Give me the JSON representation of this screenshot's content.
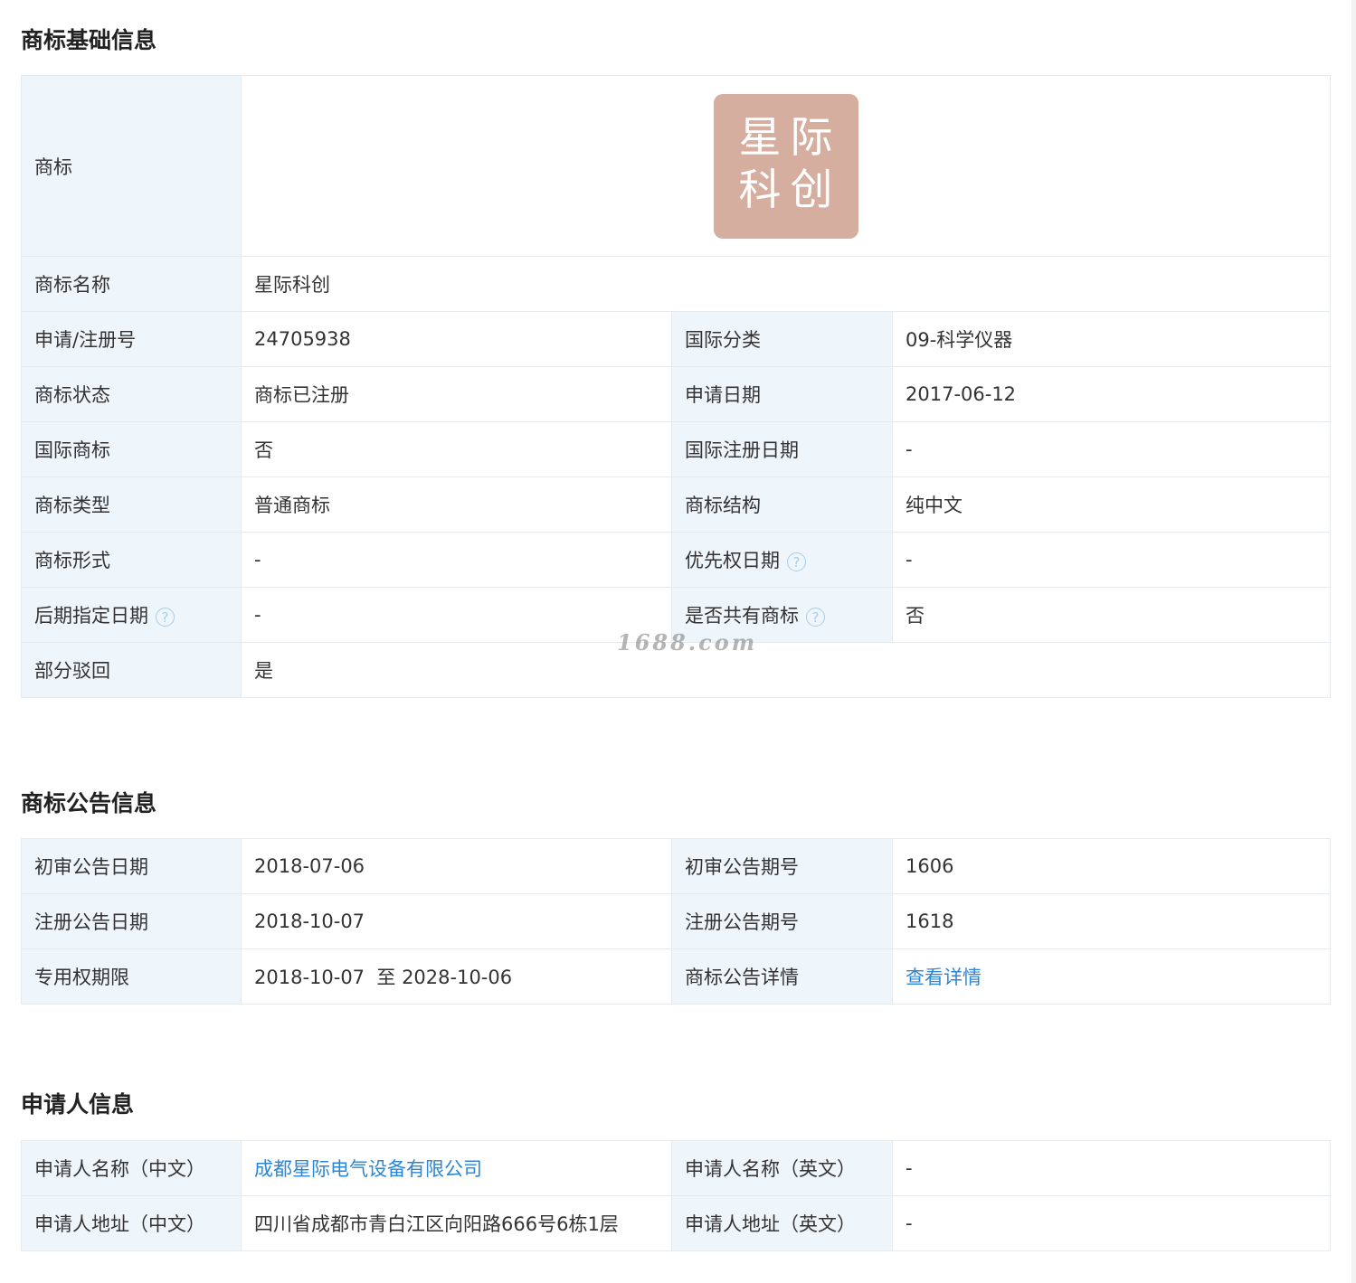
{
  "basic": {
    "title": "商标基础信息",
    "logo_label": "商标",
    "logo": {
      "line1": "星际",
      "line2": "科创",
      "bg_color": "#d5ae9f"
    },
    "name_label": "商标名称",
    "name_value": "星际科创",
    "rows": [
      {
        "l1": "申请/注册号",
        "v1": "24705938",
        "l2": "国际分类",
        "v2": "09-科学仪器"
      },
      {
        "l1": "商标状态",
        "v1": "商标已注册",
        "l2": "申请日期",
        "v2": "2017-06-12"
      },
      {
        "l1": "国际商标",
        "v1": "否",
        "l2": "国际注册日期",
        "v2": "-"
      },
      {
        "l1": "商标类型",
        "v1": "普通商标",
        "l2": "商标结构",
        "v2": "纯中文"
      },
      {
        "l1": "商标形式",
        "v1": "-",
        "l2": "优先权日期",
        "v2": "-"
      },
      {
        "l1": "后期指定日期",
        "v1": "-",
        "l2": "是否共有商标",
        "v2": "否"
      }
    ],
    "partial_label": "部分驳回",
    "partial_value": "是"
  },
  "help_glyph": "?",
  "notice": {
    "title": "商标公告信息",
    "rows": [
      {
        "l1": "初审公告日期",
        "v1": "2018-07-06",
        "l2": "初审公告期号",
        "v2": "1606"
      },
      {
        "l1": "注册公告日期",
        "v1": "2018-10-07",
        "l2": "注册公告期号",
        "v2": "1618"
      },
      {
        "l1": "专用权期限",
        "v1": "2018-10-07  至 2028-10-06",
        "l2": "商标公告详情",
        "v2": "查看详情"
      }
    ]
  },
  "applicant": {
    "title": "申请人信息",
    "rows": [
      {
        "l1": "申请人名称（中文）",
        "v1": "成都星际电气设备有限公司",
        "l2": "申请人名称（英文）",
        "v2": "-"
      },
      {
        "l1": "申请人地址（中文）",
        "v1": "四川省成都市青白江区向阳路666号6栋1层",
        "l2": "申请人地址（英文）",
        "v2": "-"
      }
    ]
  },
  "watermark": "1688.com",
  "colors": {
    "label_bg": "#eef5fb",
    "link": "#2a86d8",
    "border": "#e6e9ee",
    "help_icon": "#a9cdec"
  }
}
